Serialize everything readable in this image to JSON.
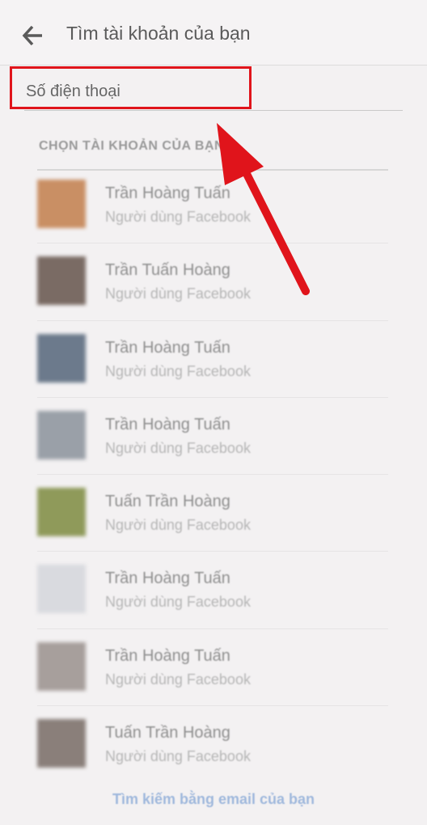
{
  "header": {
    "title": "Tìm tài khoản của bạn",
    "back_icon": "arrow-left-icon"
  },
  "search": {
    "placeholder": "Số điện thoại",
    "value": ""
  },
  "list": {
    "title": "CHỌN TÀI KHOẢN CỦA BẠN",
    "items": [
      {
        "name": "Trần Hoàng Tuấn",
        "subtitle": "Người dùng Facebook",
        "avatar_color": "#c98f64"
      },
      {
        "name": "Trần Tuấn Hoàng",
        "subtitle": "Người dùng Facebook",
        "avatar_color": "#7a6b64"
      },
      {
        "name": "Trần Hoàng Tuấn",
        "subtitle": "Người dùng Facebook",
        "avatar_color": "#6c7a8c"
      },
      {
        "name": "Trần Hoàng Tuấn",
        "subtitle": "Người dùng Facebook",
        "avatar_color": "#9aa0a8"
      },
      {
        "name": "Tuấn Trần Hoàng",
        "subtitle": "Người dùng Facebook",
        "avatar_color": "#8f9a5a"
      },
      {
        "name": "Trần Hoàng Tuấn",
        "subtitle": "Người dùng Facebook",
        "avatar_color": "#d9dadf"
      },
      {
        "name": "Trần Hoàng Tuấn",
        "subtitle": "Người dùng Facebook",
        "avatar_color": "#a79f9c"
      },
      {
        "name": "Tuấn Trần Hoàng",
        "subtitle": "Người dùng Facebook",
        "avatar_color": "#8a7f7a"
      }
    ]
  },
  "footer": {
    "email_link": "Tìm kiếm bằng email của bạn"
  },
  "colors": {
    "highlight": "#e0141b",
    "link": "#9fb8dc"
  }
}
